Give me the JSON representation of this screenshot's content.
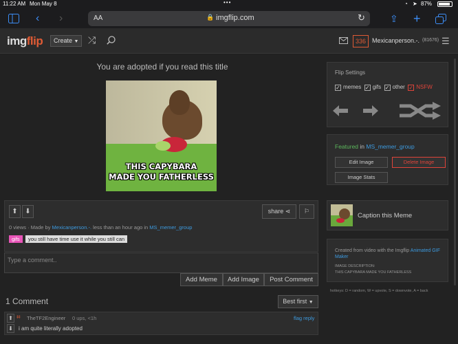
{
  "status": {
    "time": "11:22 AM",
    "date": "Mon May 8",
    "battery": "87%"
  },
  "browser": {
    "aa": "AA",
    "url": "imgflip.com"
  },
  "header": {
    "logo_img": "img",
    "logo_flip": "flip",
    "create": "Create",
    "points": "336",
    "username": "Mexicanperson.-.",
    "user_badge": "(81676)"
  },
  "post": {
    "title": "You are adopted if you read this title",
    "caption_line1": "THIS CAPYBARA",
    "caption_line2": "MADE YOU FATHERLESS",
    "share": "share",
    "meta_views": "0 views · Made by ",
    "meta_author": "Mexicanperson.-.",
    "meta_time": " less than an hour ago in ",
    "meta_stream": "MS_memer_group",
    "tag_gifs": "gifs",
    "tag_text": "you still have time use it while you still can"
  },
  "comment_box": {
    "placeholder": "Type a comment..",
    "add_meme": "Add Meme",
    "add_image": "Add Image",
    "post_comment": "Post Comment"
  },
  "comments": {
    "count": "1 Comment",
    "sort": "Best first",
    "item": {
      "user": "TheTF2Engineer",
      "meta": "0 ups, <1h",
      "actions": "flag reply",
      "text": "i am quite literally adopted"
    }
  },
  "flip_settings": {
    "title": "Flip Settings",
    "memes": "memes",
    "gifs": "gifs",
    "other": "other",
    "nsfw": "NSFW"
  },
  "featured": {
    "prefix": "Featured",
    "in": " in ",
    "stream": "MS_memer_group",
    "edit": "Edit Image",
    "delete": "Delete Image",
    "stats": "Image Stats"
  },
  "caption_meme": {
    "label": "Caption this Meme"
  },
  "info": {
    "created_prefix": "Created from video with the Imgflip ",
    "created_link": "Animated GIF Maker",
    "desc_label": "IMAGE DESCRIPTION:",
    "desc_text": "THIS CAPYBARA MADE YOU FATHERLESS",
    "hotkeys": "hotkeys: D = random, W = upvote, S = downvote, A = back"
  },
  "colors": {
    "accent": "#3d9be0",
    "brand": "#e05b35",
    "nsfw": "#e0443a",
    "featured": "#5cb85c"
  }
}
